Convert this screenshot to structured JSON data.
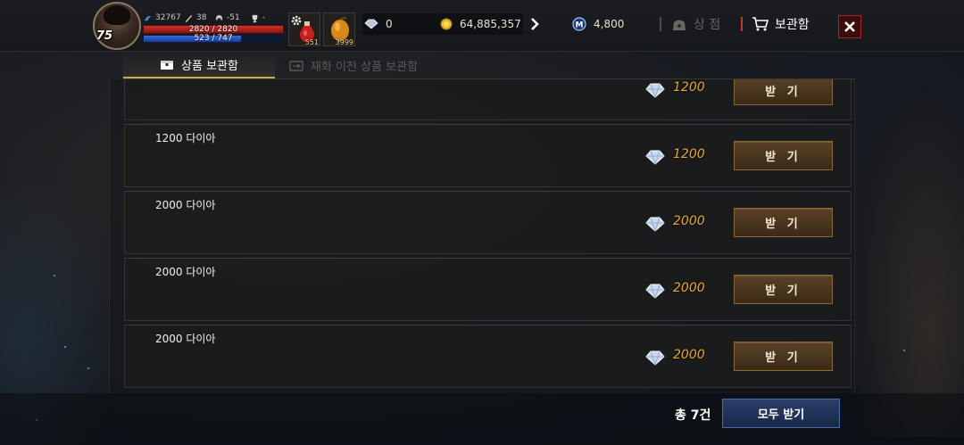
{
  "player": {
    "level": "75",
    "power": "32767",
    "attack": "38",
    "defense": "-51",
    "rank": "-",
    "hp_text": "2820 / 2820",
    "hp_fraction": 1.0,
    "mp_text": "523 / 747",
    "mp_fraction": 0.7
  },
  "items": {
    "potion_count": "551",
    "fruit_count": "3999"
  },
  "currency": {
    "diamond": "0",
    "gold": "64,885,357",
    "medal": "4,800"
  },
  "menu": {
    "shop_label": "상 점",
    "storage_label": "보관함"
  },
  "tabs": {
    "active_label": "상품 보관함",
    "inactive_label": "재화 이전 상품 보관함"
  },
  "claim_label": "받 기",
  "rows": [
    {
      "title": "",
      "amount": "1200"
    },
    {
      "title": "1200 다이아",
      "amount": "1200"
    },
    {
      "title": "2000 다이아",
      "amount": "2000"
    },
    {
      "title": "2000 다이아",
      "amount": "2000"
    },
    {
      "title": "2000 다이아",
      "amount": "2000"
    }
  ],
  "footer": {
    "total_label": "총 7건",
    "claim_all_label": "모두 받기"
  },
  "colors": {
    "amount": "#e6a830",
    "claim_button": "#4a3420",
    "claim_all_button": "#213258",
    "close_button": "#a02a2a"
  },
  "icons": [
    "gear-icon",
    "potion-icon",
    "fruit-icon",
    "diamond-icon",
    "gold-coin-icon",
    "medal-icon",
    "shop-bag-icon",
    "cart-icon",
    "close-icon",
    "chest-icon"
  ]
}
